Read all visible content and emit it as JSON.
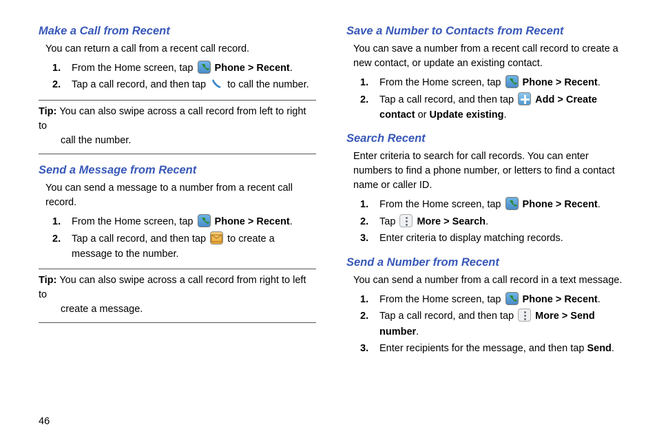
{
  "page_number": "46",
  "left": {
    "s1": {
      "heading": "Make a Call from Recent",
      "intro": "You can return a call from a recent call record.",
      "step1_a": "From the Home screen, tap ",
      "step1_b": "Phone > Recent",
      "step1_c": ".",
      "step2_a": "Tap a call record, and then tap ",
      "step2_b": " to call the number.",
      "tip_label": "Tip: ",
      "tip_a": "You can also swipe across a call record from left to right to",
      "tip_b": "call the number."
    },
    "s2": {
      "heading": "Send a Message from Recent",
      "intro": "You can send a message to a number from a recent call record.",
      "step1_a": "From the Home screen, tap ",
      "step1_b": "Phone > Recent",
      "step1_c": ".",
      "step2_a": "Tap a call record, and then tap ",
      "step2_b": " to create a message to the number.",
      "tip_label": "Tip: ",
      "tip_a": "You can also swipe across a call record from right to left to",
      "tip_b": "create a message."
    }
  },
  "right": {
    "s1": {
      "heading": "Save a Number to Contacts from Recent",
      "intro": "You can save a number from a recent call record to create a new contact, or update an existing contact.",
      "step1_a": "From the Home screen, tap ",
      "step1_b": "Phone > Recent",
      "step1_c": ".",
      "step2_a": "Tap a call record, and then tap ",
      "step2_b": "Add > Create contact",
      "step2_c": " or ",
      "step2_d": "Update existing",
      "step2_e": "."
    },
    "s2": {
      "heading": "Search Recent",
      "intro": "Enter criteria to search for call records. You can enter numbers to find a phone number, or letters to find a contact name or caller ID.",
      "step1_a": "From the Home screen, tap ",
      "step1_b": "Phone > Recent",
      "step1_c": ".",
      "step2_a": "Tap ",
      "step2_b": "More > Search",
      "step2_c": ".",
      "step3": "Enter criteria to display matching records."
    },
    "s3": {
      "heading": "Send a Number from Recent",
      "intro": "You can send a number from a call record in a text message.",
      "step1_a": "From the Home screen, tap ",
      "step1_b": "Phone > Recent",
      "step1_c": ".",
      "step2_a": "Tap a call record, and then tap ",
      "step2_b": "More > Send number",
      "step2_c": ".",
      "step3_a": "Enter recipients for the message, and then tap ",
      "step3_b": "Send",
      "step3_c": "."
    }
  }
}
